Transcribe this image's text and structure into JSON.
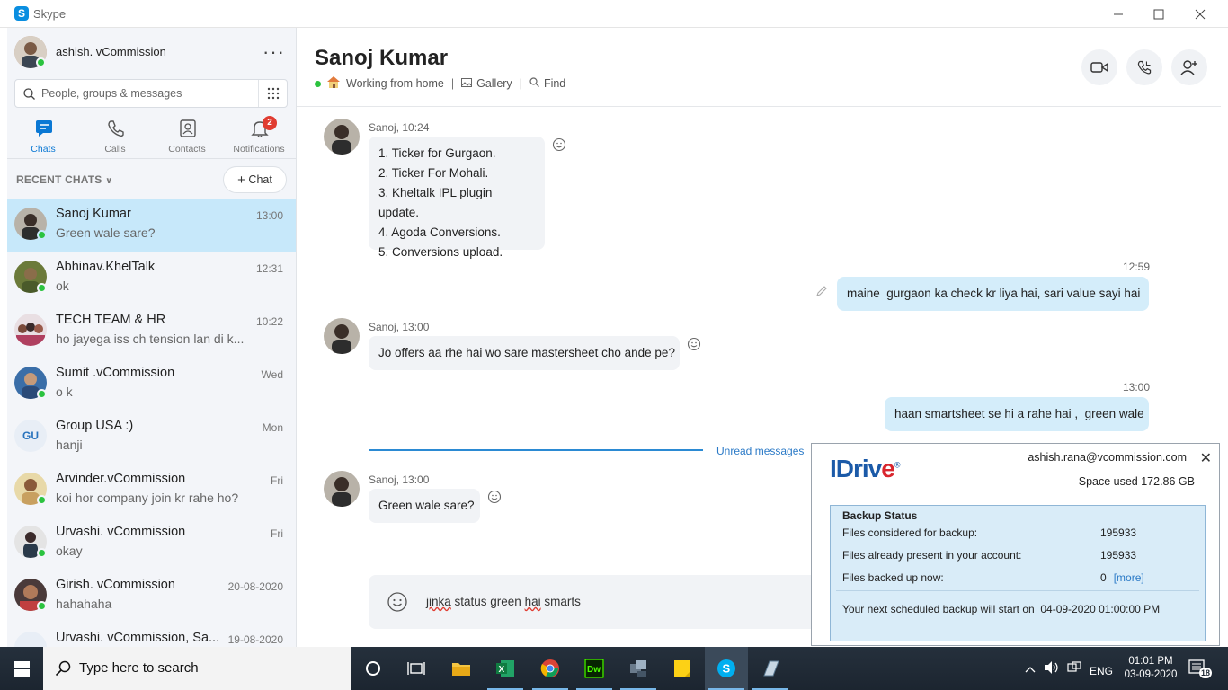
{
  "window": {
    "title": "Skype"
  },
  "profile": {
    "name": "ashish. vCommission"
  },
  "search": {
    "placeholder": "People, groups & messages"
  },
  "nav": {
    "chats": "Chats",
    "calls": "Calls",
    "contacts": "Contacts",
    "notifications": "Notifications",
    "notifications_badge": "2"
  },
  "recent": {
    "header": "RECENT CHATS",
    "new_chat": "Chat"
  },
  "chats": [
    {
      "name": "Sanoj Kumar",
      "preview": "Green wale sare?",
      "time": "13:00"
    },
    {
      "name": "Abhinav.KhelTalk",
      "preview": "ok",
      "time": "12:31"
    },
    {
      "name": "TECH TEAM & HR",
      "preview": "ho jayega iss ch tension lan di k...",
      "time": "10:22"
    },
    {
      "name": "Sumit .vCommission",
      "preview": "o k",
      "time": "Wed"
    },
    {
      "name": "Group USA :)",
      "preview": "hanji",
      "time": "Mon",
      "initials": "GU"
    },
    {
      "name": "Arvinder.vCommission",
      "preview": "koi hor company join kr rahe ho?",
      "time": "Fri"
    },
    {
      "name": "Urvashi. vCommission",
      "preview": "okay",
      "time": "Fri"
    },
    {
      "name": "Girish. vCommission",
      "preview": "hahahaha",
      "time": "20-08-2020"
    },
    {
      "name": "Urvashi. vCommission, Sa...",
      "preview": "",
      "time": "19-08-2020"
    }
  ],
  "conversation": {
    "title": "Sanoj Kumar",
    "status": "Working from home",
    "gallery": "Gallery",
    "find": "Find"
  },
  "messages": {
    "m1_sender": "Sanoj, 10:24",
    "m1_lines": [
      "1. Ticker for Gurgaon.",
      "2. Ticker For Mohali.",
      "3. Kheltalk IPL plugin update.",
      "4. Agoda Conversions.",
      "5. Conversions upload."
    ],
    "m2_time": "12:59",
    "m2_text": "maine  gurgaon ka check kr liya hai, sari value sayi hai",
    "m3_sender": "Sanoj, 13:00",
    "m3_text": "Jo offers aa rhe hai wo sare mastersheet cho ande pe?",
    "m4_time": "13:00",
    "m4_text": "haan smartsheet se hi a rahe hai ,  green wale",
    "unread": "Unread messages",
    "m5_sender": "Sanoj, 13:00",
    "m5_text": "Green wale sare?"
  },
  "compose": {
    "word1": "jinka",
    "word2": " status green ",
    "word3": "hai",
    "word4": " smarts"
  },
  "idrive": {
    "logo_a": "IDriv",
    "logo_e": "e",
    "logo_r": "®",
    "email": "ashish.rana@vcommission.com",
    "space": "Space used 172.86 GB",
    "panel_title": "Backup Status",
    "row1_label": "Files considered for backup:",
    "row1_value": "195933",
    "row2_label": "Files already present in your account:",
    "row2_value": "195933",
    "row3_label": "Files backed up now:",
    "row3_value": "0",
    "more": "[more]",
    "next_label": "Your next scheduled backup will start on",
    "next_value": "04-09-2020 01:00:00 PM"
  },
  "taskbar": {
    "search_placeholder": "Type here to search",
    "lang": "ENG",
    "time": "01:01 PM",
    "date": "03-09-2020",
    "notif_count": "18"
  }
}
